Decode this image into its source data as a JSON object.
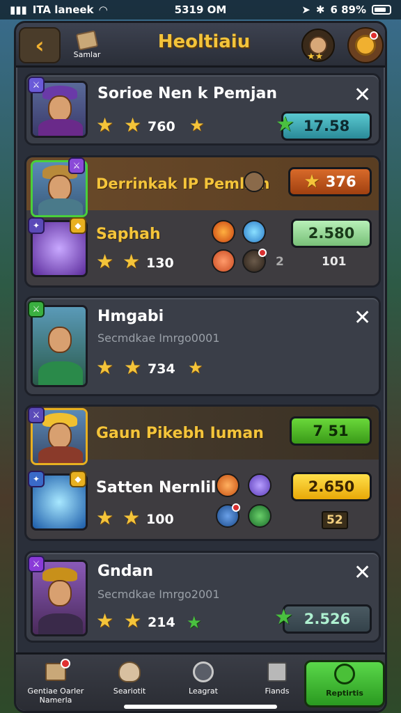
{
  "status_bar": {
    "carrier": "ITA laneek",
    "time": "5319 OM",
    "battery": "6 89%"
  },
  "header": {
    "back_icon": "chevron-left-icon",
    "shop_label": "Samlar",
    "title": "Heoltiaiu",
    "title_color": "#f4c43a"
  },
  "cards": [
    {
      "name": "Sorioe Nen k Pemjan",
      "stars": 2,
      "score": "760",
      "value": "17.58",
      "value_style": "teal"
    },
    {
      "name": "Derrinkak IP Pemlian",
      "badge_value": "376",
      "badge_style": "orange",
      "sub_name": "Saphah",
      "sub_stars": 2,
      "sub_score": "130",
      "sub_value": "2.580",
      "sub_value_style": "mint",
      "sub_extra": "101",
      "sub_mark": "2"
    },
    {
      "name": "Hmgabi",
      "subtitle": "Secmdkae Imrgo0001",
      "stars": 2,
      "score": "734"
    },
    {
      "name": "Gaun Pikebh Iuman",
      "badge_value": "7 51",
      "badge_style": "green",
      "sub_name": "Satten Nernliler",
      "sub_stars": 2,
      "sub_score": "100",
      "sub_value": "2.650",
      "sub_value_style": "yellow",
      "sub_extra": "52"
    },
    {
      "name": "Gndan",
      "subtitle": "Secmdkae Imrgo2001",
      "stars": 2,
      "score": "214",
      "value": "2.526",
      "value_style": "slate"
    }
  ],
  "bottom_nav": [
    {
      "label": "Gentiae Oarler Namerla",
      "icon": "crate-icon",
      "active": false
    },
    {
      "label": "Seariotit",
      "icon": "shell-icon",
      "active": false
    },
    {
      "label": "Leagrat",
      "icon": "compass-icon",
      "active": false
    },
    {
      "label": "Fiands",
      "icon": "box-icon",
      "active": false
    },
    {
      "label": "Reptirtis",
      "icon": "gear-icon",
      "active": true
    }
  ]
}
